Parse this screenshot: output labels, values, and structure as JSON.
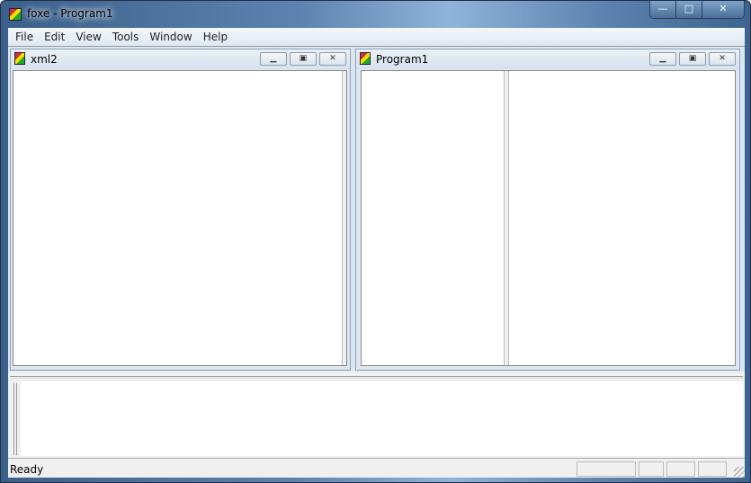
{
  "window": {
    "title": "foxe - Program1",
    "buttons": {
      "minimize": "—",
      "maximize": "□",
      "close": "✕"
    }
  },
  "menu": [
    "File",
    "Edit",
    "View",
    "Tools",
    "Window",
    "Help"
  ],
  "children": [
    {
      "title": "xml2"
    },
    {
      "title": "Program1"
    }
  ],
  "child_buttons": {
    "minimize": "▁",
    "restore": "▣",
    "close": "✕"
  },
  "status": {
    "text": "Ready"
  }
}
